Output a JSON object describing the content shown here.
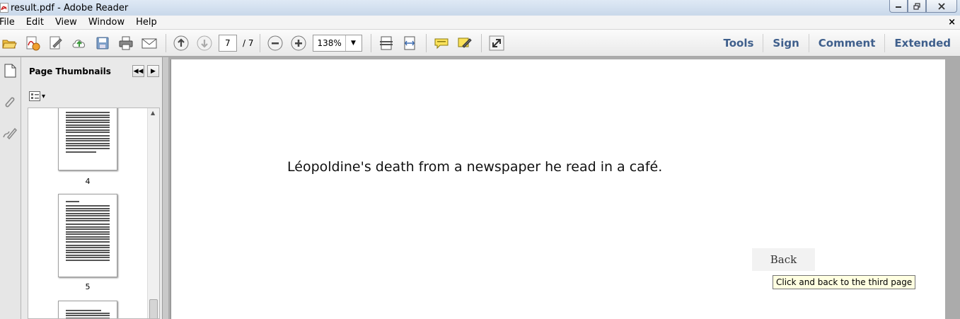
{
  "window": {
    "title": "result.pdf - Adobe Reader",
    "minimize_label": "▭",
    "restore_label": "❐",
    "close_label": "✕"
  },
  "menu": {
    "items": [
      "File",
      "Edit",
      "View",
      "Window",
      "Help"
    ],
    "close_label": "×"
  },
  "toolbar": {
    "current_page": "7",
    "total_pages": "/ 7",
    "zoom": "138%",
    "zoom_drop": "▼",
    "right_links": [
      "Tools",
      "Sign",
      "Comment",
      "Extended"
    ]
  },
  "thumbnails": {
    "title": "Page Thumbnails",
    "collapse_label": "◀◀",
    "expand_label": "▶",
    "options_label": "▾",
    "pages": [
      {
        "number": "4"
      },
      {
        "number": "5"
      }
    ]
  },
  "document": {
    "text": "Léopoldine's death from a newspaper he read in a café.",
    "back_button": "Back",
    "tooltip": "Click and back to the third page"
  },
  "colors": {
    "link_blue": "#3f5f8c",
    "tooltip_bg": "#ffffe1"
  }
}
